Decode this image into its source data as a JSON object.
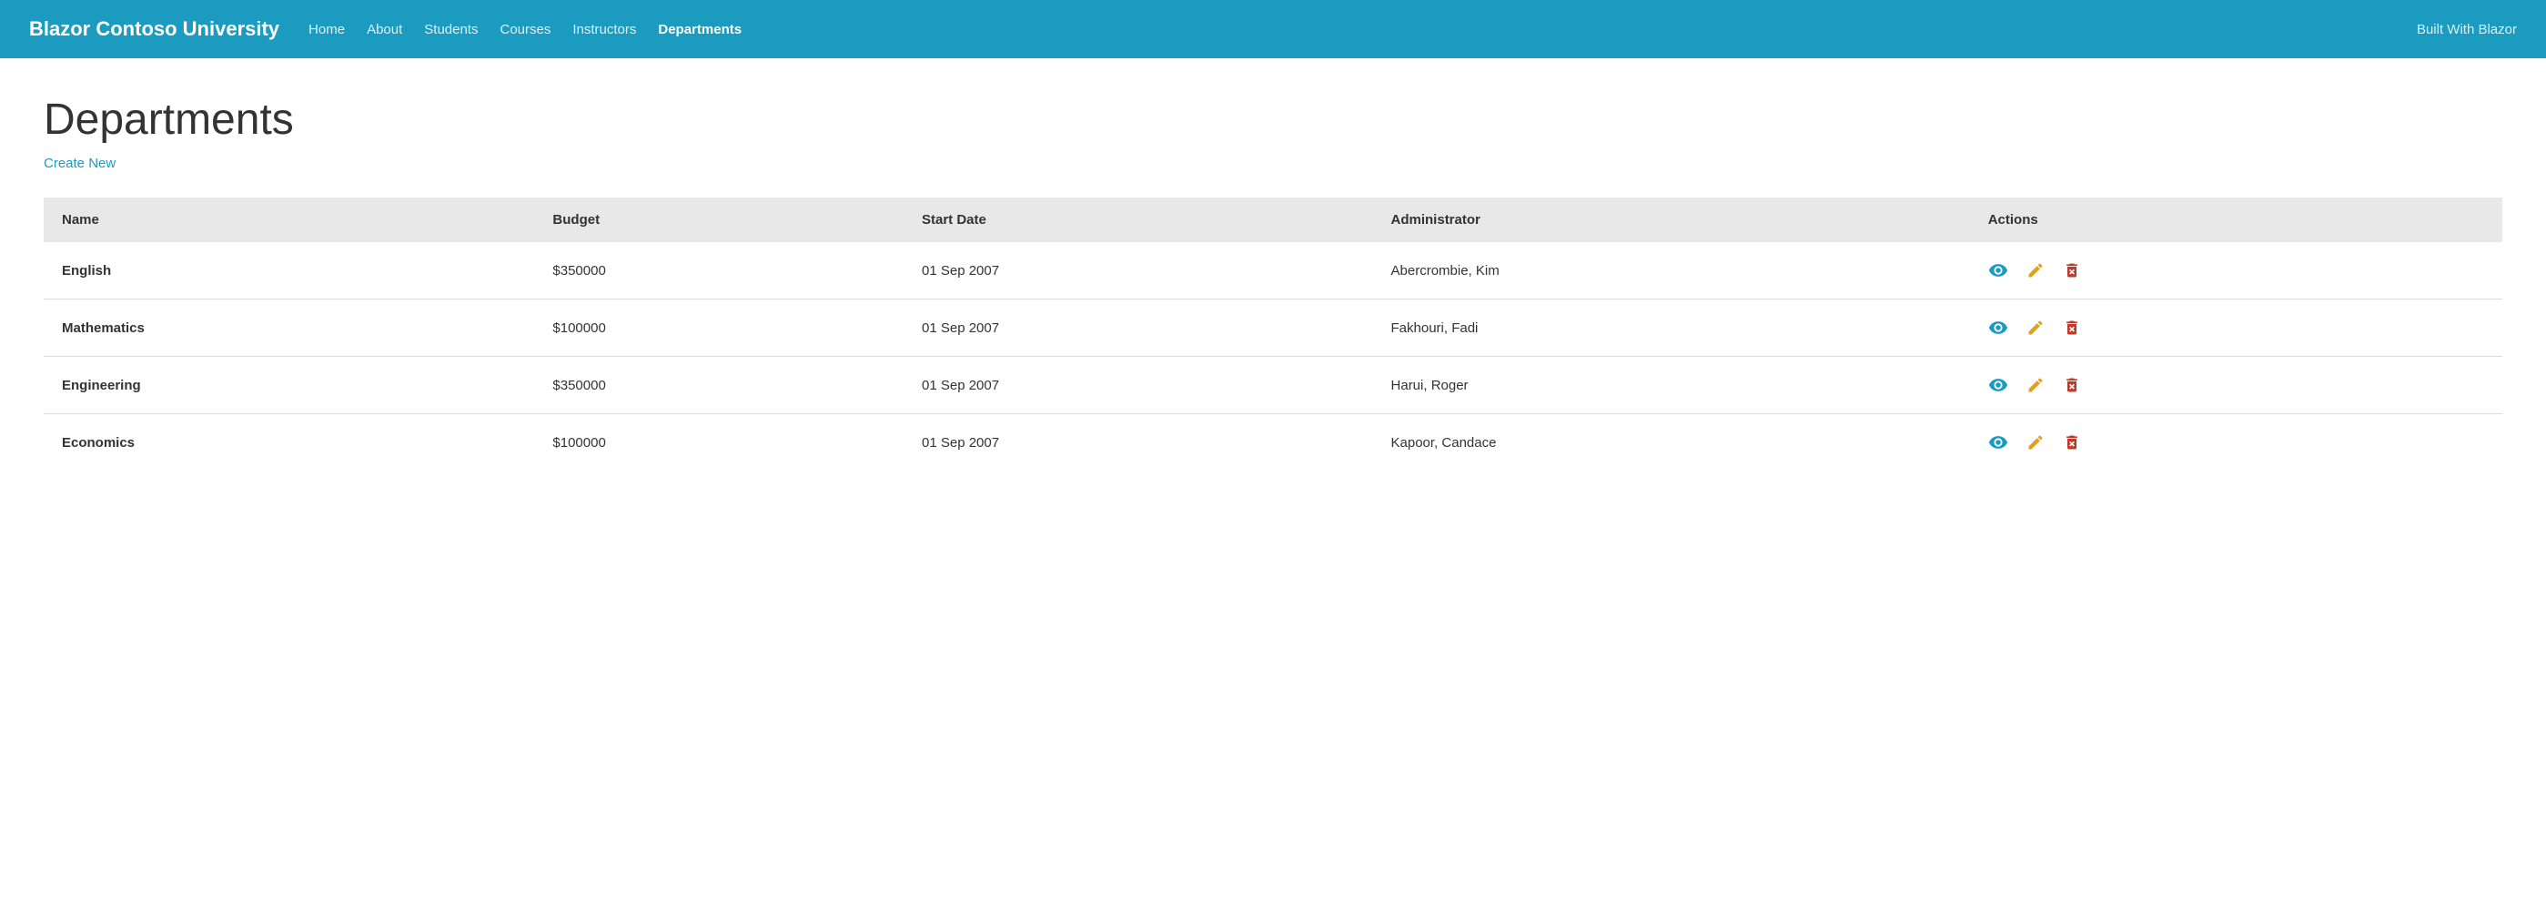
{
  "nav": {
    "brand": "Blazor Contoso University",
    "links": [
      {
        "label": "Home",
        "active": false
      },
      {
        "label": "About",
        "active": false
      },
      {
        "label": "Students",
        "active": false
      },
      {
        "label": "Courses",
        "active": false
      },
      {
        "label": "Instructors",
        "active": false
      },
      {
        "label": "Departments",
        "active": true
      }
    ],
    "right_text": "Built With Blazor"
  },
  "page": {
    "title": "Departments",
    "create_new": "Create New"
  },
  "table": {
    "columns": [
      "Name",
      "Budget",
      "Start Date",
      "Administrator",
      "Actions"
    ],
    "rows": [
      {
        "name": "English",
        "budget": "$350000",
        "start_date": "01 Sep 2007",
        "administrator": "Abercrombie, Kim"
      },
      {
        "name": "Mathematics",
        "budget": "$100000",
        "start_date": "01 Sep 2007",
        "administrator": "Fakhouri, Fadi"
      },
      {
        "name": "Engineering",
        "budget": "$350000",
        "start_date": "01 Sep 2007",
        "administrator": "Harui, Roger"
      },
      {
        "name": "Economics",
        "budget": "$100000",
        "start_date": "01 Sep 2007",
        "administrator": "Kapoor, Candace"
      }
    ]
  }
}
